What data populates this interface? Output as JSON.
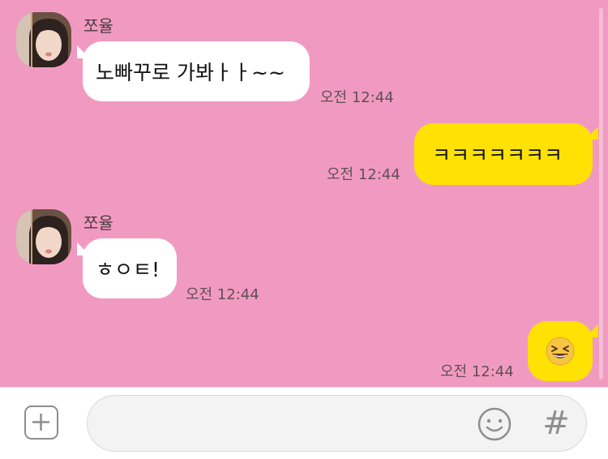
{
  "messages": [
    {
      "sender": "쪼율",
      "text": "노빠꾸로 가봐ㅏㅏ~~",
      "time": "오전 12:44"
    },
    {
      "text": "ㅋㅋㅋㅋㅋㅋㅋ",
      "time": "오전 12:44"
    },
    {
      "sender": "쪼율",
      "text": "ㅎㅇㅌ!",
      "time": "오전 12:44"
    },
    {
      "emoji": "grinning-squinting-face",
      "time": "오전 12:44"
    }
  ],
  "input": {
    "placeholder": ""
  },
  "icons": {
    "attach": "plus-icon",
    "emoji": "smiley-icon",
    "hashtag": "hashtag-icon"
  },
  "colors": {
    "background": "#f19ac1",
    "incoming_bubble": "#ffffff",
    "outgoing_bubble": "#ffe203"
  }
}
